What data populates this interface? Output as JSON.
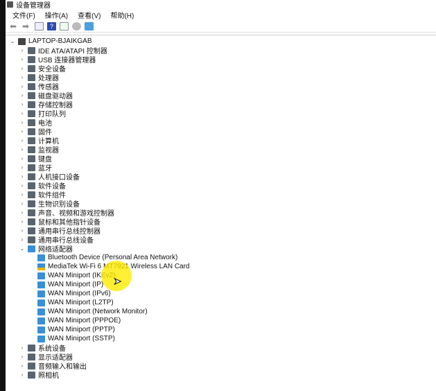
{
  "window": {
    "title": "设备管理器"
  },
  "menu": [
    "文件(F)",
    "操作(A)",
    "查看(V)",
    "帮助(H)"
  ],
  "toolbar": [
    "back-icon",
    "forward-icon",
    "properties-icon",
    "help-icon",
    "view-icon",
    "scan-hardware-icon",
    "monitor-icon"
  ],
  "tree": {
    "root": "LAPTOP-BJAIKGAB",
    "categories_before": [
      "IDE ATA/ATAPI 控制器",
      "USB 连接器管理器",
      "安全设备",
      "处理器",
      "传感器",
      "磁盘驱动器",
      "存储控制器",
      "打印队列",
      "电池",
      "固件",
      "计算机",
      "监视器",
      "键盘",
      "蓝牙",
      "人机接口设备",
      "软件设备",
      "软件组件",
      "生物识别设备",
      "声音、视频和游戏控制器",
      "鼠标和其他指针设备",
      "通用串行总线控制器",
      "通用串行总线设备"
    ],
    "expanded": {
      "label": "网络适配器",
      "children": [
        {
          "label": "Bluetooth Device (Personal Area Network)",
          "warning": false
        },
        {
          "label": "MediaTek Wi-Fi 6 MT7921 Wireless LAN Card",
          "warning": true
        },
        {
          "label": "WAN Miniport (IKEv2)",
          "warning": false
        },
        {
          "label": "WAN Miniport (IP)",
          "warning": false
        },
        {
          "label": "WAN Miniport (IPv6)",
          "warning": false
        },
        {
          "label": "WAN Miniport (L2TP)",
          "warning": false
        },
        {
          "label": "WAN Miniport (Network Monitor)",
          "warning": false
        },
        {
          "label": "WAN Miniport (PPPOE)",
          "warning": false
        },
        {
          "label": "WAN Miniport (PPTP)",
          "warning": false
        },
        {
          "label": "WAN Miniport (SSTP)",
          "warning": false
        }
      ]
    },
    "categories_after": [
      "系统设备",
      "显示适配器",
      "音频输入和输出",
      "照相机"
    ]
  },
  "colors": {
    "net": "#3a8fd6",
    "device": "#5a6470",
    "warning": "#f0b400"
  }
}
